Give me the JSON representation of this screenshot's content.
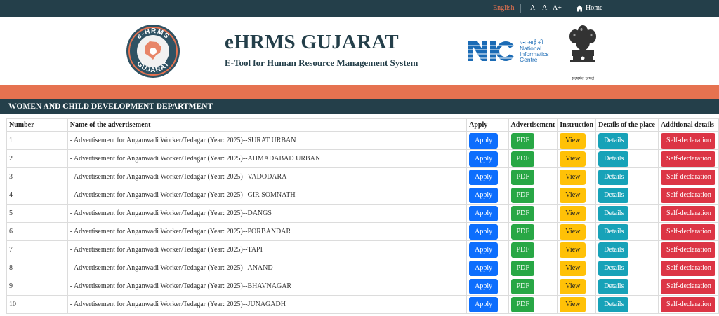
{
  "topbar": {
    "language": "English",
    "font_decrease": "A-",
    "font_normal": "A",
    "font_increase": "A+",
    "home_label": "Home"
  },
  "header": {
    "logo_text_top": "e-HRMS",
    "logo_text_bottom": "GUJARAT",
    "title": "eHRMS GUJARAT",
    "subtitle": "E-Tool for Human Resource Management System",
    "nic_hindi": "एन आई सी",
    "nic_line1": "National",
    "nic_line2": "Informatics",
    "nic_line3": "Centre",
    "emblem_caption": "सत्यमेव जयते"
  },
  "department": "WOMEN AND CHILD DEVELOPMENT DEPARTMENT",
  "table": {
    "headers": [
      "Number",
      "Name of the advertisement",
      "Apply",
      "Advertisement",
      "Instruction",
      "Details of the place",
      "Additional details"
    ],
    "button_labels": {
      "apply": "Apply",
      "pdf": "PDF",
      "view": "View",
      "details": "Details",
      "self": "Self-declaration"
    },
    "rows": [
      {
        "number": "1",
        "name": "- Advertisement for Anganwadi Worker/Tedagar (Year: 2025)--SURAT URBAN"
      },
      {
        "number": "2",
        "name": "- Advertisement for Anganwadi Worker/Tedagar (Year: 2025)--AHMADABAD URBAN"
      },
      {
        "number": "3",
        "name": "- Advertisement for Anganwadi Worker/Tedagar (Year: 2025)--VADODARA"
      },
      {
        "number": "4",
        "name": "- Advertisement for Anganwadi Worker/Tedagar (Year: 2025)--GIR SOMNATH"
      },
      {
        "number": "5",
        "name": "- Advertisement for Anganwadi Worker/Tedagar (Year: 2025)--DANGS"
      },
      {
        "number": "6",
        "name": "- Advertisement for Anganwadi Worker/Tedagar (Year: 2025)--PORBANDAR"
      },
      {
        "number": "7",
        "name": "- Advertisement for Anganwadi Worker/Tedagar (Year: 2025)--TAPI"
      },
      {
        "number": "8",
        "name": "- Advertisement for Anganwadi Worker/Tedagar (Year: 2025)--ANAND"
      },
      {
        "number": "9",
        "name": "- Advertisement for Anganwadi Worker/Tedagar (Year: 2025)--BHAVNAGAR"
      },
      {
        "number": "10",
        "name": "- Advertisement for Anganwadi Worker/Tedagar (Year: 2025)--JUNAGADH"
      }
    ]
  },
  "colors": {
    "topbar": "#243f4a",
    "accent_orange": "#e67250",
    "apply": "#0d6efd",
    "pdf": "#28a745",
    "view": "#ffc107",
    "details": "#17a2b8",
    "self": "#dc3545"
  }
}
